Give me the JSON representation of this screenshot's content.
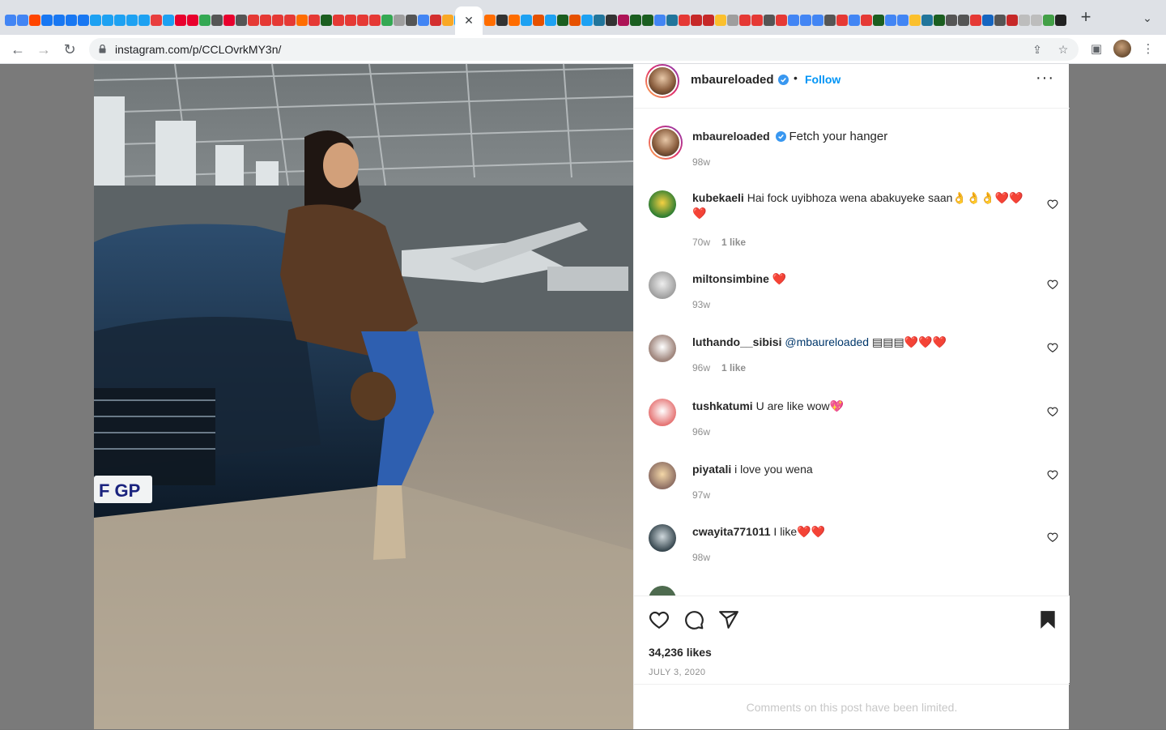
{
  "browser": {
    "url": "instagram.com/p/CCLOvrkMY3n/",
    "new_tab_icon": "plus-icon",
    "tab_close_icon": "close-icon",
    "tab_search_icon": "chevron-down-icon"
  },
  "post": {
    "author": "mbaureloaded",
    "follow_label": "Follow",
    "caption": "Fetch your hanger",
    "caption_time": "98w",
    "likes": "34,236 likes",
    "date": "JULY 3, 2020",
    "limited_notice": "Comments on this post have been limited."
  },
  "comments": [
    {
      "user": "kubekaeli",
      "text": "Hai fock uyibhoza wena abakuyeke saan👌👌👌❤️❤️❤️",
      "time": "70w",
      "likes": "1 like"
    },
    {
      "user": "miltonsimbine",
      "text": "❤️",
      "time": "93w",
      "likes": ""
    },
    {
      "user": "luthando__sibisi",
      "mention": "@mbaureloaded",
      "text": "▤▤▤❤️❤️❤️",
      "time": "96w",
      "likes": "1 like"
    },
    {
      "user": "tushkatumi",
      "text": "U are like wow💖",
      "time": "96w",
      "likes": ""
    },
    {
      "user": "piyatali",
      "text": "i love you wena",
      "time": "97w",
      "likes": ""
    },
    {
      "user": "cwayita771011",
      "text": "I like❤️❤️",
      "time": "98w",
      "likes": ""
    }
  ],
  "colors": {
    "link": "#0095f6",
    "text": "#262626",
    "muted": "#8e8e8e",
    "verified": "#3897f0"
  }
}
